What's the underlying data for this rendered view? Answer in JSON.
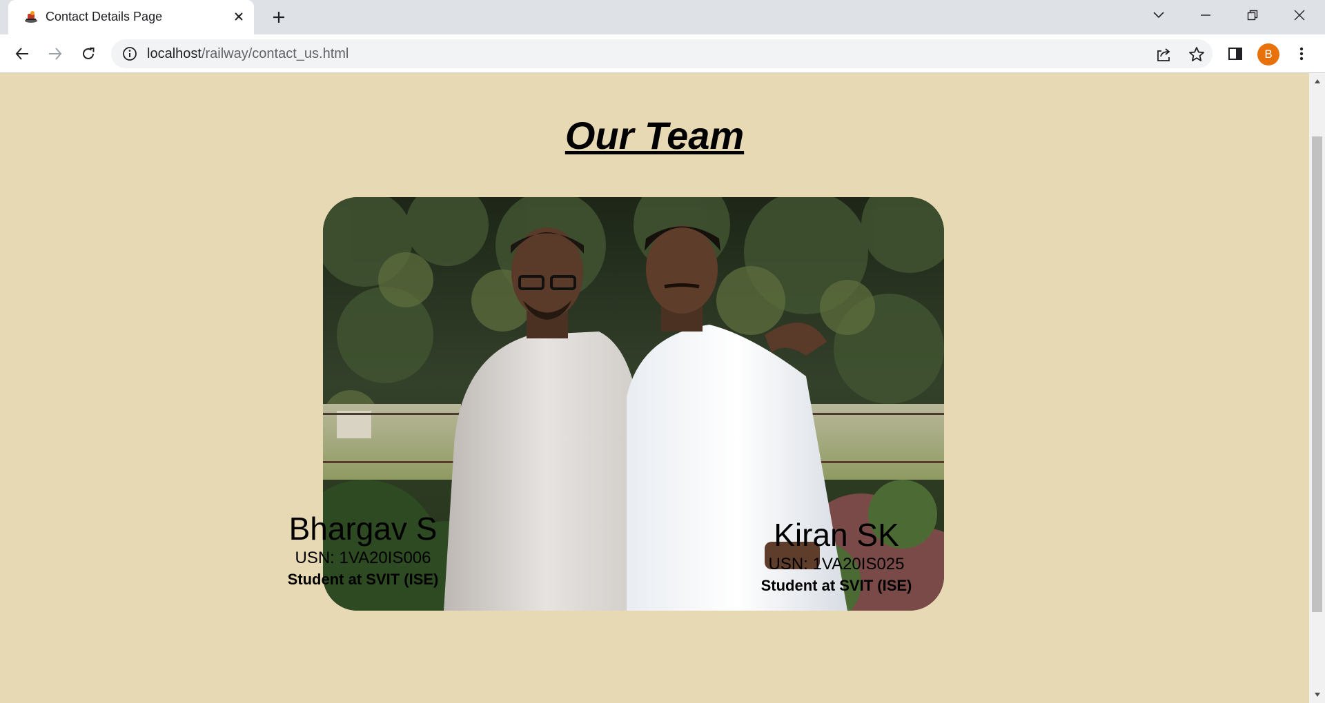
{
  "browser": {
    "tab": {
      "title": "Contact Details Page",
      "favicon": "railway-logo-icon"
    },
    "window_controls": [
      "tab-search",
      "minimize",
      "restore",
      "close"
    ],
    "address": {
      "host": "localhost",
      "path": "/railway/contact_us.html"
    },
    "profile_initial": "B",
    "profile_color": "#e8710a"
  },
  "page": {
    "background": "#e8d9b5",
    "heading": "Our Team",
    "team_photo": "team-photo",
    "members": [
      {
        "name": "Bhargav S",
        "usn": "USN: 1VA20IS006",
        "role": "Student at SVIT (ISE)"
      },
      {
        "name": "Kiran SK",
        "usn": "USN: 1VA20IS025",
        "role": "Student at SVIT (ISE)"
      }
    ]
  }
}
